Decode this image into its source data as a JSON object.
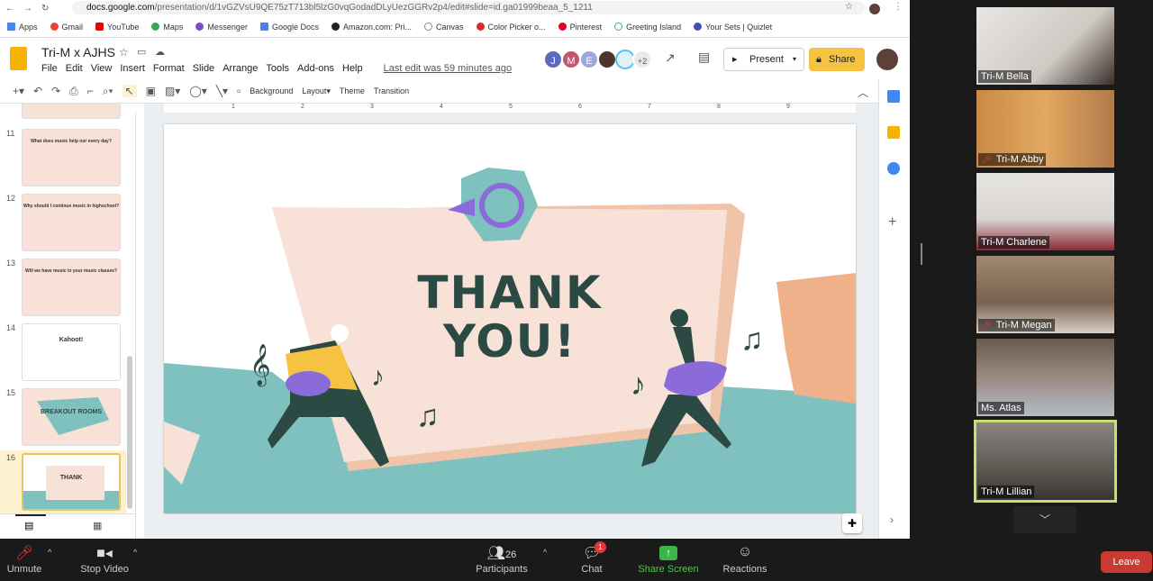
{
  "browser": {
    "url_host": "docs.google.com",
    "url_path": "/presentation/d/1vGZVsU9QE75zT713bl5lzG0vqGodadDLyUezGGRv2p4/edit#slide=id.ga01999beaa_5_1211",
    "bookmarks": [
      "Apps",
      "Gmail",
      "YouTube",
      "Maps",
      "Messenger",
      "Google Docs",
      "Amazon.com: Pri...",
      "Canvas",
      "Color Picker o...",
      "Pinterest",
      "Greeting Island",
      "Your Sets | Quizlet"
    ]
  },
  "doc": {
    "title": "Tri-M x AJHS",
    "menus": [
      "File",
      "Edit",
      "View",
      "Insert",
      "Format",
      "Slide",
      "Arrange",
      "Tools",
      "Add-ons",
      "Help"
    ],
    "last_edit": "Last edit was 59 minutes ago",
    "collaborators": [
      {
        "initial": "J",
        "color": "#5c6bc0"
      },
      {
        "initial": "M",
        "color": "#c2566f"
      },
      {
        "initial": "E",
        "color": "#9fa8da"
      },
      {
        "initial": "",
        "color": "#4e342e"
      },
      {
        "initial": "",
        "color": "#e0f2f1"
      }
    ],
    "more_collaborators": "+2",
    "present_label": "Present",
    "share_label": "Share"
  },
  "toolbar": {
    "background": "Background",
    "layout": "Layout",
    "theme": "Theme",
    "transition": "Transition"
  },
  "ruler_marks": [
    "1",
    "2",
    "3",
    "4",
    "5",
    "6",
    "7",
    "8",
    "9"
  ],
  "filmstrip": [
    {
      "num": "11",
      "title": "What does music help our every day?"
    },
    {
      "num": "12",
      "title": "Why should I continue music in highschool?"
    },
    {
      "num": "13",
      "title": "Will we have music in your music classes?"
    },
    {
      "num": "14",
      "title": "Kahoot!"
    },
    {
      "num": "15",
      "title": "BREAKOUT ROOMS"
    },
    {
      "num": "16",
      "title": "THANK YOU!",
      "selected": true
    }
  ],
  "slide": {
    "line1": "THANK",
    "line2": "YOU!"
  },
  "colors": {
    "peach": "#f8e1d6",
    "teal": "#7fc1bf",
    "dark": "#2b4a44",
    "purple": "#8b6bd9",
    "orange": "#f0b08a",
    "share": "#f5c242",
    "leave": "#c83a32",
    "active_speaker": "#c8e06b"
  },
  "participants_video": [
    {
      "name": "Tri-M Bella",
      "muted": false
    },
    {
      "name": "Tri-M Abby",
      "muted": true
    },
    {
      "name": "Tri-M Charlene",
      "muted": false
    },
    {
      "name": "Tri-M Megan",
      "muted": true
    },
    {
      "name": "Ms. Atlas",
      "muted": false
    },
    {
      "name": "Tri-M Lillian",
      "muted": false,
      "active": true
    }
  ],
  "zoom": {
    "unmute": "Unmute",
    "stop_video": "Stop Video",
    "participants": "Participants",
    "participants_count": "26",
    "chat": "Chat",
    "chat_badge": "1",
    "share_screen": "Share Screen",
    "reactions": "Reactions",
    "leave": "Leave"
  }
}
